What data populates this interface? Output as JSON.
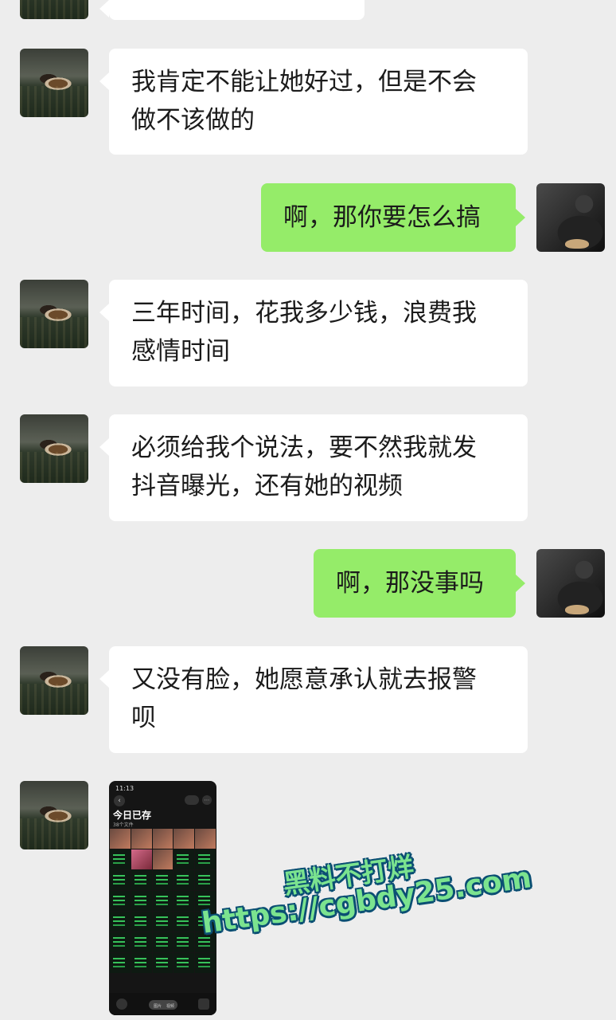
{
  "messages": [
    {
      "side": "left",
      "text": ""
    },
    {
      "side": "left",
      "text": "我肯定不能让她好过，但是不会\n做不该做的"
    },
    {
      "side": "right",
      "text": "啊，那你要怎么搞"
    },
    {
      "side": "left",
      "text": "三年时间，花我多少钱，浪费我\n感情时间"
    },
    {
      "side": "left",
      "text": "必须给我个说法，要不然我就发\n抖音曝光，还有她的视频"
    },
    {
      "side": "right",
      "text": "啊，那没事吗"
    },
    {
      "side": "left",
      "text": "又没有脸，她愿意承认就去报警\n呗"
    }
  ],
  "image_message": {
    "status_time": "11:13",
    "title": "今日已存",
    "subtitle": "38个文件",
    "segment_left": "图片",
    "segment_right": "视频"
  },
  "watermark": {
    "line1": "黑料不打烊",
    "line2": "https://cgbdy25.com"
  },
  "colors": {
    "background": "#ededed",
    "incoming_bubble": "#ffffff",
    "outgoing_bubble": "#95ec69",
    "watermark_fill": "#7be38f",
    "watermark_outline": "#0b4f73"
  }
}
